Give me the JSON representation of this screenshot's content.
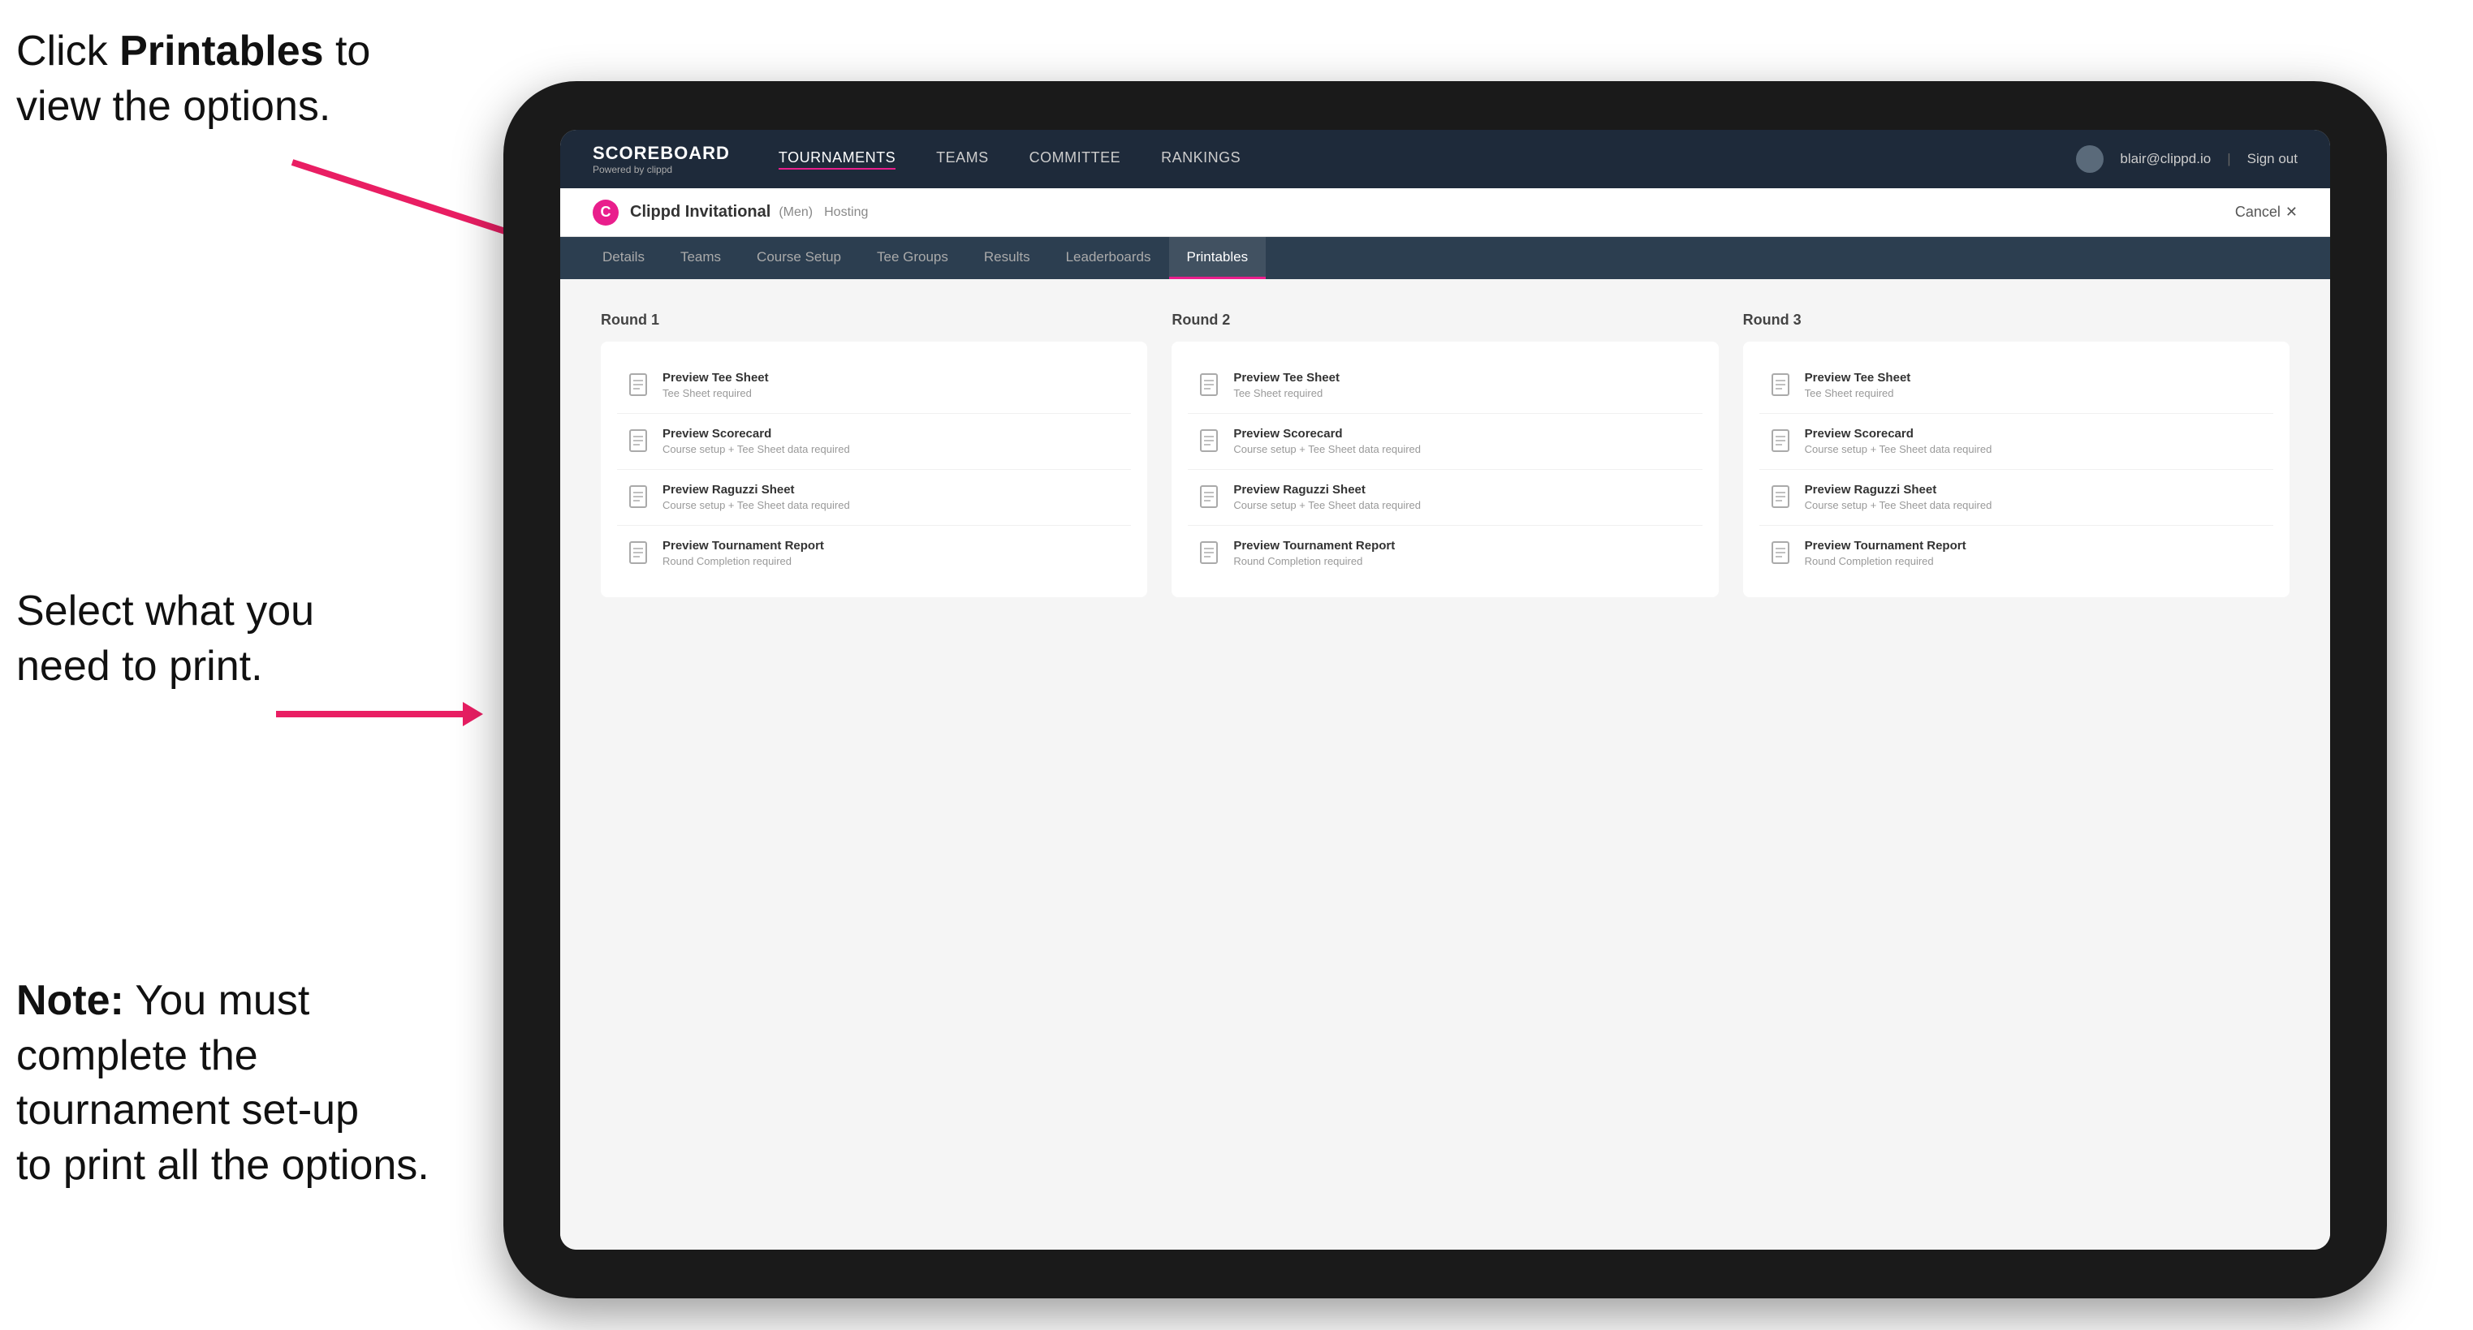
{
  "instructions": {
    "top": "Click ",
    "top_bold": "Printables",
    "top_rest": " to view the options.",
    "middle_line1": "Select what you",
    "middle_line2": "need to print.",
    "bottom_bold": "Note:",
    "bottom_rest": " You must complete the tournament set-up to print all the options."
  },
  "nav": {
    "logo_title": "SCOREBOARD",
    "logo_sub": "Powered by clippd",
    "links": [
      "TOURNAMENTS",
      "TEAMS",
      "COMMITTEE",
      "RANKINGS"
    ],
    "active_link": "TOURNAMENTS",
    "user_email": "blair@clippd.io",
    "sign_in_label": "Sign out"
  },
  "tournament": {
    "logo_letter": "C",
    "name": "Clippd Invitational",
    "division": "(Men)",
    "hosting": "Hosting",
    "cancel_label": "Cancel"
  },
  "tabs": {
    "items": [
      "Details",
      "Teams",
      "Course Setup",
      "Tee Groups",
      "Results",
      "Leaderboards",
      "Printables"
    ],
    "active": "Printables"
  },
  "rounds": [
    {
      "label": "Round 1",
      "items": [
        {
          "title": "Preview Tee Sheet",
          "sub": "Tee Sheet required"
        },
        {
          "title": "Preview Scorecard",
          "sub": "Course setup + Tee Sheet data required"
        },
        {
          "title": "Preview Raguzzi Sheet",
          "sub": "Course setup + Tee Sheet data required"
        },
        {
          "title": "Preview Tournament Report",
          "sub": "Round Completion required"
        }
      ]
    },
    {
      "label": "Round 2",
      "items": [
        {
          "title": "Preview Tee Sheet",
          "sub": "Tee Sheet required"
        },
        {
          "title": "Preview Scorecard",
          "sub": "Course setup + Tee Sheet data required"
        },
        {
          "title": "Preview Raguzzi Sheet",
          "sub": "Course setup + Tee Sheet data required"
        },
        {
          "title": "Preview Tournament Report",
          "sub": "Round Completion required"
        }
      ]
    },
    {
      "label": "Round 3",
      "items": [
        {
          "title": "Preview Tee Sheet",
          "sub": "Tee Sheet required"
        },
        {
          "title": "Preview Scorecard",
          "sub": "Course setup + Tee Sheet data required"
        },
        {
          "title": "Preview Raguzzi Sheet",
          "sub": "Course setup + Tee Sheet data required"
        },
        {
          "title": "Preview Tournament Report",
          "sub": "Round Completion required"
        }
      ]
    }
  ]
}
